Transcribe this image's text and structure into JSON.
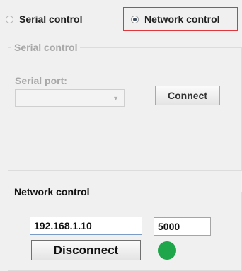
{
  "mode_selector": {
    "serial_option": "Serial control",
    "network_option": "Network control",
    "selected": "network"
  },
  "serial_group": {
    "title": "Serial control",
    "port_label": "Serial port:",
    "port_value": "",
    "connect_label": "Connect",
    "enabled": false
  },
  "network_group": {
    "title": "Network control",
    "ip_value": "192.168.1.10",
    "port_value": "5000",
    "disconnect_label": "Disconnect",
    "status_color": "#1fa64a",
    "connected": true
  },
  "colors": {
    "highlight": "#e0363d",
    "status_connected": "#1fa64a"
  }
}
